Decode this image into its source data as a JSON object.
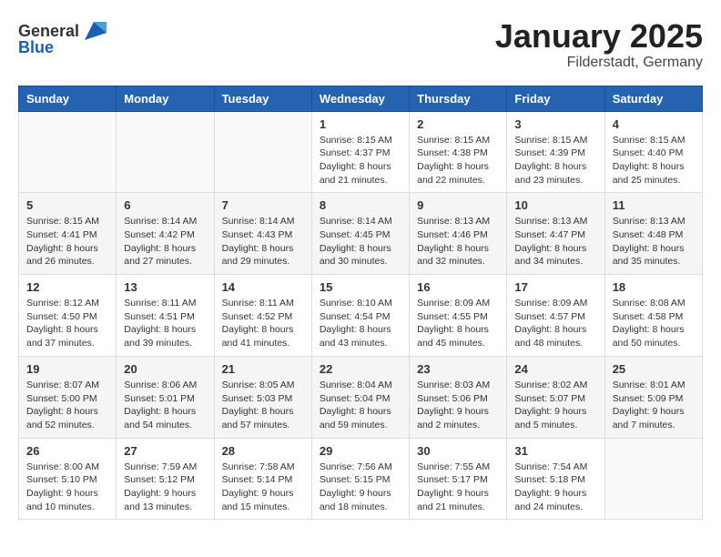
{
  "header": {
    "logo_general": "General",
    "logo_blue": "Blue",
    "title": "January 2025",
    "subtitle": "Filderstadt, Germany"
  },
  "days_of_week": [
    "Sunday",
    "Monday",
    "Tuesday",
    "Wednesday",
    "Thursday",
    "Friday",
    "Saturday"
  ],
  "weeks": [
    [
      {
        "day": "",
        "sunrise": "",
        "sunset": "",
        "daylight": ""
      },
      {
        "day": "",
        "sunrise": "",
        "sunset": "",
        "daylight": ""
      },
      {
        "day": "",
        "sunrise": "",
        "sunset": "",
        "daylight": ""
      },
      {
        "day": "1",
        "sunrise": "Sunrise: 8:15 AM",
        "sunset": "Sunset: 4:37 PM",
        "daylight": "Daylight: 8 hours and 21 minutes."
      },
      {
        "day": "2",
        "sunrise": "Sunrise: 8:15 AM",
        "sunset": "Sunset: 4:38 PM",
        "daylight": "Daylight: 8 hours and 22 minutes."
      },
      {
        "day": "3",
        "sunrise": "Sunrise: 8:15 AM",
        "sunset": "Sunset: 4:39 PM",
        "daylight": "Daylight: 8 hours and 23 minutes."
      },
      {
        "day": "4",
        "sunrise": "Sunrise: 8:15 AM",
        "sunset": "Sunset: 4:40 PM",
        "daylight": "Daylight: 8 hours and 25 minutes."
      }
    ],
    [
      {
        "day": "5",
        "sunrise": "Sunrise: 8:15 AM",
        "sunset": "Sunset: 4:41 PM",
        "daylight": "Daylight: 8 hours and 26 minutes."
      },
      {
        "day": "6",
        "sunrise": "Sunrise: 8:14 AM",
        "sunset": "Sunset: 4:42 PM",
        "daylight": "Daylight: 8 hours and 27 minutes."
      },
      {
        "day": "7",
        "sunrise": "Sunrise: 8:14 AM",
        "sunset": "Sunset: 4:43 PM",
        "daylight": "Daylight: 8 hours and 29 minutes."
      },
      {
        "day": "8",
        "sunrise": "Sunrise: 8:14 AM",
        "sunset": "Sunset: 4:45 PM",
        "daylight": "Daylight: 8 hours and 30 minutes."
      },
      {
        "day": "9",
        "sunrise": "Sunrise: 8:13 AM",
        "sunset": "Sunset: 4:46 PM",
        "daylight": "Daylight: 8 hours and 32 minutes."
      },
      {
        "day": "10",
        "sunrise": "Sunrise: 8:13 AM",
        "sunset": "Sunset: 4:47 PM",
        "daylight": "Daylight: 8 hours and 34 minutes."
      },
      {
        "day": "11",
        "sunrise": "Sunrise: 8:13 AM",
        "sunset": "Sunset: 4:48 PM",
        "daylight": "Daylight: 8 hours and 35 minutes."
      }
    ],
    [
      {
        "day": "12",
        "sunrise": "Sunrise: 8:12 AM",
        "sunset": "Sunset: 4:50 PM",
        "daylight": "Daylight: 8 hours and 37 minutes."
      },
      {
        "day": "13",
        "sunrise": "Sunrise: 8:11 AM",
        "sunset": "Sunset: 4:51 PM",
        "daylight": "Daylight: 8 hours and 39 minutes."
      },
      {
        "day": "14",
        "sunrise": "Sunrise: 8:11 AM",
        "sunset": "Sunset: 4:52 PM",
        "daylight": "Daylight: 8 hours and 41 minutes."
      },
      {
        "day": "15",
        "sunrise": "Sunrise: 8:10 AM",
        "sunset": "Sunset: 4:54 PM",
        "daylight": "Daylight: 8 hours and 43 minutes."
      },
      {
        "day": "16",
        "sunrise": "Sunrise: 8:09 AM",
        "sunset": "Sunset: 4:55 PM",
        "daylight": "Daylight: 8 hours and 45 minutes."
      },
      {
        "day": "17",
        "sunrise": "Sunrise: 8:09 AM",
        "sunset": "Sunset: 4:57 PM",
        "daylight": "Daylight: 8 hours and 48 minutes."
      },
      {
        "day": "18",
        "sunrise": "Sunrise: 8:08 AM",
        "sunset": "Sunset: 4:58 PM",
        "daylight": "Daylight: 8 hours and 50 minutes."
      }
    ],
    [
      {
        "day": "19",
        "sunrise": "Sunrise: 8:07 AM",
        "sunset": "Sunset: 5:00 PM",
        "daylight": "Daylight: 8 hours and 52 minutes."
      },
      {
        "day": "20",
        "sunrise": "Sunrise: 8:06 AM",
        "sunset": "Sunset: 5:01 PM",
        "daylight": "Daylight: 8 hours and 54 minutes."
      },
      {
        "day": "21",
        "sunrise": "Sunrise: 8:05 AM",
        "sunset": "Sunset: 5:03 PM",
        "daylight": "Daylight: 8 hours and 57 minutes."
      },
      {
        "day": "22",
        "sunrise": "Sunrise: 8:04 AM",
        "sunset": "Sunset: 5:04 PM",
        "daylight": "Daylight: 8 hours and 59 minutes."
      },
      {
        "day": "23",
        "sunrise": "Sunrise: 8:03 AM",
        "sunset": "Sunset: 5:06 PM",
        "daylight": "Daylight: 9 hours and 2 minutes."
      },
      {
        "day": "24",
        "sunrise": "Sunrise: 8:02 AM",
        "sunset": "Sunset: 5:07 PM",
        "daylight": "Daylight: 9 hours and 5 minutes."
      },
      {
        "day": "25",
        "sunrise": "Sunrise: 8:01 AM",
        "sunset": "Sunset: 5:09 PM",
        "daylight": "Daylight: 9 hours and 7 minutes."
      }
    ],
    [
      {
        "day": "26",
        "sunrise": "Sunrise: 8:00 AM",
        "sunset": "Sunset: 5:10 PM",
        "daylight": "Daylight: 9 hours and 10 minutes."
      },
      {
        "day": "27",
        "sunrise": "Sunrise: 7:59 AM",
        "sunset": "Sunset: 5:12 PM",
        "daylight": "Daylight: 9 hours and 13 minutes."
      },
      {
        "day": "28",
        "sunrise": "Sunrise: 7:58 AM",
        "sunset": "Sunset: 5:14 PM",
        "daylight": "Daylight: 9 hours and 15 minutes."
      },
      {
        "day": "29",
        "sunrise": "Sunrise: 7:56 AM",
        "sunset": "Sunset: 5:15 PM",
        "daylight": "Daylight: 9 hours and 18 minutes."
      },
      {
        "day": "30",
        "sunrise": "Sunrise: 7:55 AM",
        "sunset": "Sunset: 5:17 PM",
        "daylight": "Daylight: 9 hours and 21 minutes."
      },
      {
        "day": "31",
        "sunrise": "Sunrise: 7:54 AM",
        "sunset": "Sunset: 5:18 PM",
        "daylight": "Daylight: 9 hours and 24 minutes."
      },
      {
        "day": "",
        "sunrise": "",
        "sunset": "",
        "daylight": ""
      }
    ]
  ]
}
